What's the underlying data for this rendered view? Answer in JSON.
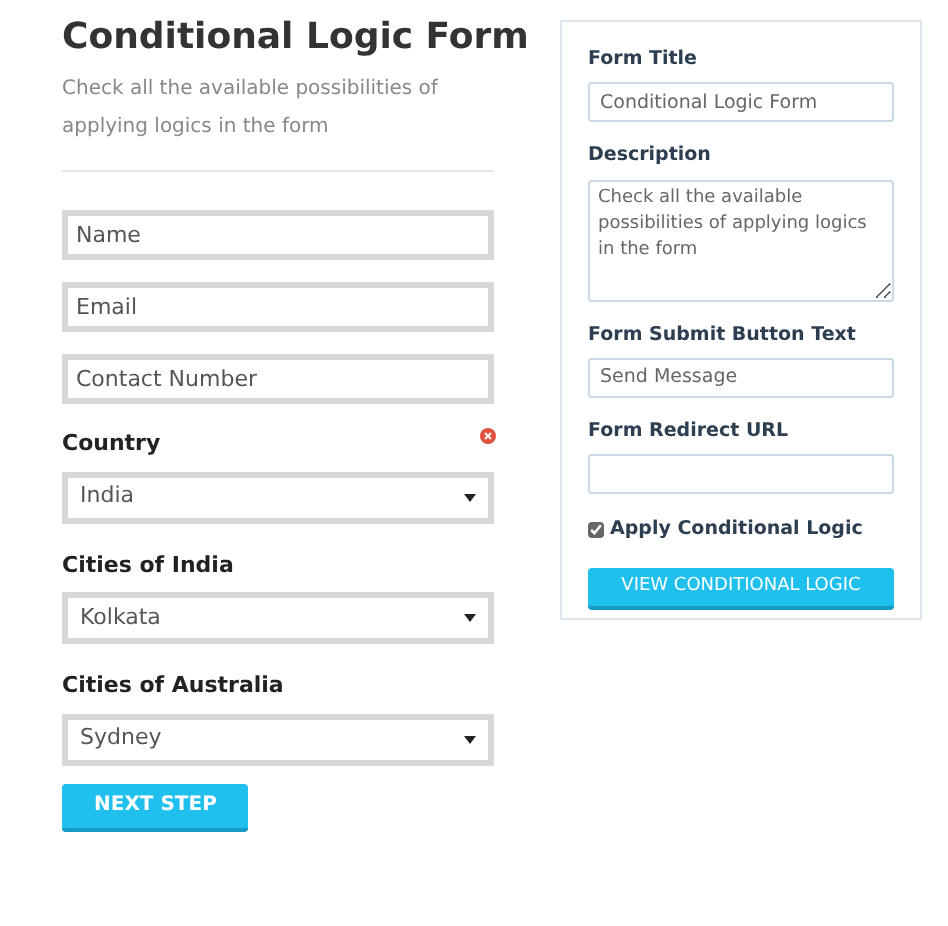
{
  "form": {
    "title": "Conditional Logic Form",
    "description": "Check all the available possibilities of applying logics in the form",
    "fields": [
      {
        "kind": "text",
        "placeholder": "Name"
      },
      {
        "kind": "text",
        "placeholder": "Email"
      },
      {
        "kind": "text",
        "placeholder": "Contact Number"
      },
      {
        "kind": "select",
        "label": "Country",
        "removable": true,
        "value": "India"
      },
      {
        "kind": "select",
        "label": "Cities of India",
        "removable": false,
        "value": "Kolkata"
      },
      {
        "kind": "select",
        "label": "Cities of Australia",
        "removable": false,
        "value": "Sydney"
      }
    ],
    "submit": "NEXT STEP"
  },
  "settings": {
    "fields": [
      {
        "kind": "input",
        "label": "Form Title",
        "value": "Conditional Logic Form"
      },
      {
        "kind": "textarea",
        "label": "Description",
        "value": "Check all the available possibilities of applying logics in the form"
      },
      {
        "kind": "input",
        "label": "Form Submit Button Text",
        "value": "Send Message"
      },
      {
        "kind": "input",
        "label": "Form Redirect URL"
      }
    ],
    "checkbox": {
      "label": "Apply Conditional Logic",
      "checked": true
    },
    "button": "VIEW CONDITIONAL LOGIC"
  }
}
